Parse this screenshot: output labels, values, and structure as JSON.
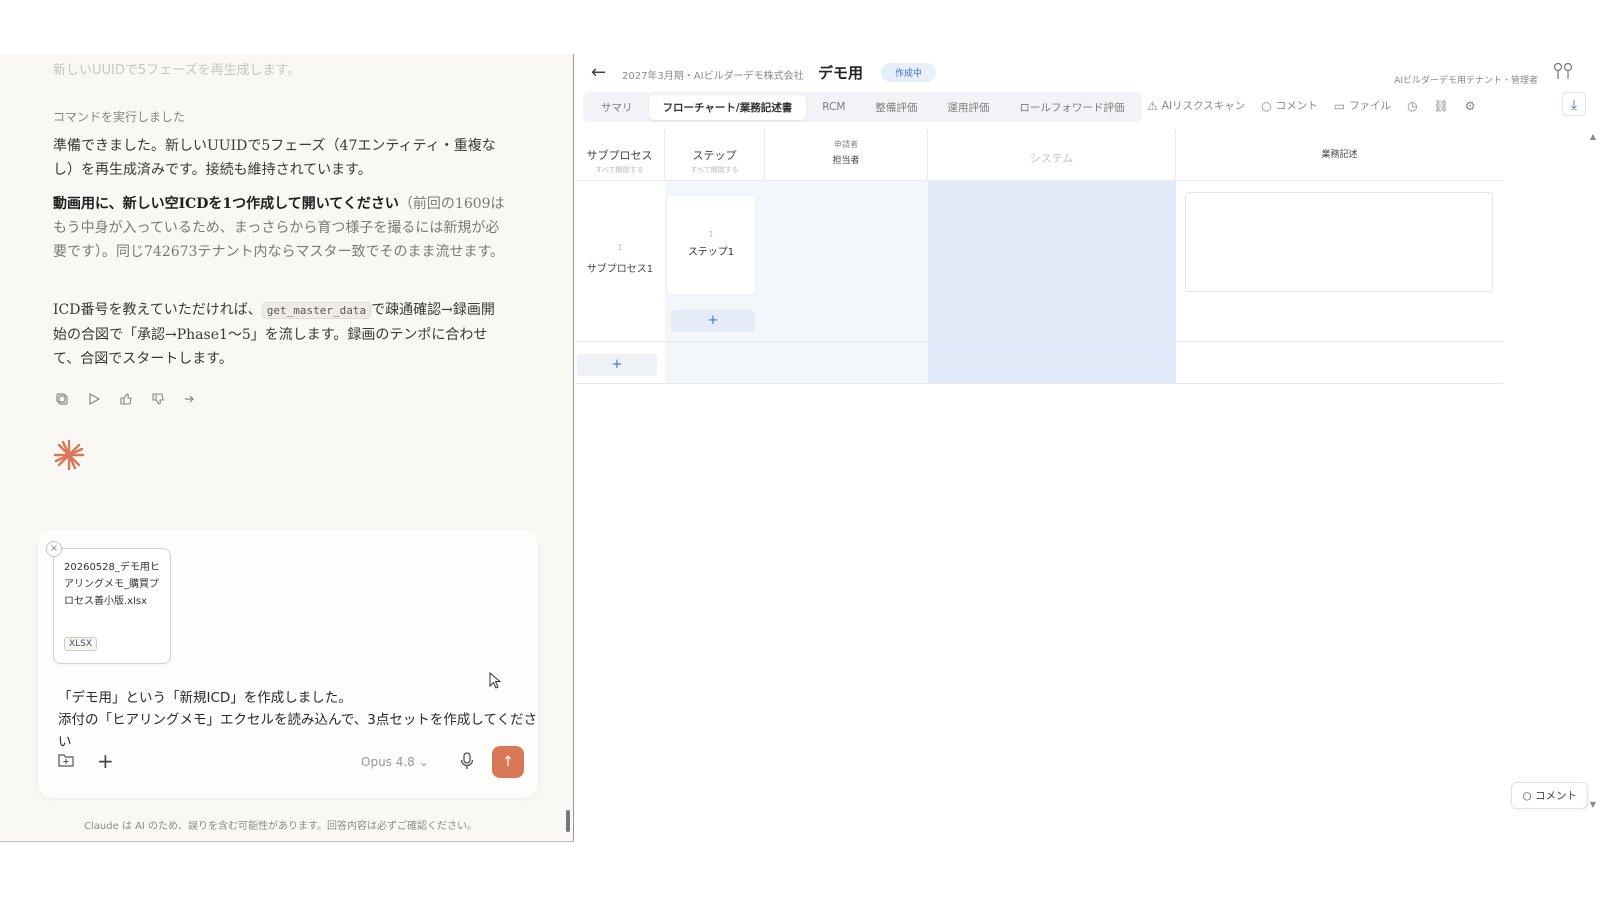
{
  "chat": {
    "faded_line": "新しいUUIDで5フェーズを再生成します。",
    "command_label": "コマンドを実行しました",
    "para1": "準備できました。新しいUUIDで5フェーズ（47エンティティ・重複なし）を再生成済みです。接続も維持されています。",
    "para2_bold": "動画用に、新しい空ICDを1つ作成して開いてください",
    "para2_rest": "（前回の1609はもう中身が入っているため、まっさらから育つ様子を撮るには新規が必要です）。同じ742673テナント内ならマスター致でそのまま流せます。",
    "para3_a": "ICD番号を教えていただければ、",
    "para3_code": "get_master_data",
    "para3_b": "で疎通確認→録画開始の合図で「承認→Phase1〜5」を流します。録画のテンポに合わせて、合図でスタートします。",
    "action_icons": [
      "copy-icon",
      "play-icon",
      "thumbs-up-icon",
      "thumbs-down-icon",
      "share-icon"
    ],
    "attachment": {
      "filename": "20260528_デモ用ヒアリングメモ_購買プロセス善小版.xlsx",
      "type": "XLSX"
    },
    "message": [
      "「デモ用」という「新規ICD」を作成しました。",
      "添付の「ヒアリングメモ」エクセルを読み込んで、3点セットを作成してください"
    ],
    "model": "Opus 4.8",
    "disclaimer": "Claude は AI のため、誤りを含む可能性があります。回答内容は必ずご確認ください。"
  },
  "app": {
    "breadcrumb": "2027年3月期・AIビルダーデモ株式会社",
    "title": "デモ用",
    "status": "作成中",
    "tenant": "AIビルダーデモ用テナント・管理者",
    "tabs": [
      "サマリ",
      "フローチャート/業務記述書",
      "RCM",
      "整備評価",
      "運用評価",
      "ロールフォワード評価"
    ],
    "active_tab": "フローチャート/業務記述書",
    "tools": {
      "ai_scan": "AIリスクスキャン",
      "comment": "コメント",
      "file": "ファイル"
    },
    "columns": {
      "subprocess": "サブプロセス",
      "subprocess_sub": "すべて開閉する",
      "step": "ステップ",
      "step_sub": "すべて開閉する",
      "applicant": "申請者",
      "approver": "担当者",
      "system": "システム",
      "description": "業務記述"
    },
    "subprocess_num": "1",
    "subprocess_label": "サブプロセス1",
    "step_num": "1",
    "step_label": "ステップ1",
    "add": "+",
    "comment_button": "コメント"
  },
  "colors": {
    "accent_orange": "#d97757",
    "accent_blue": "#3a6fd6",
    "system_column": "#dfe9f7"
  }
}
